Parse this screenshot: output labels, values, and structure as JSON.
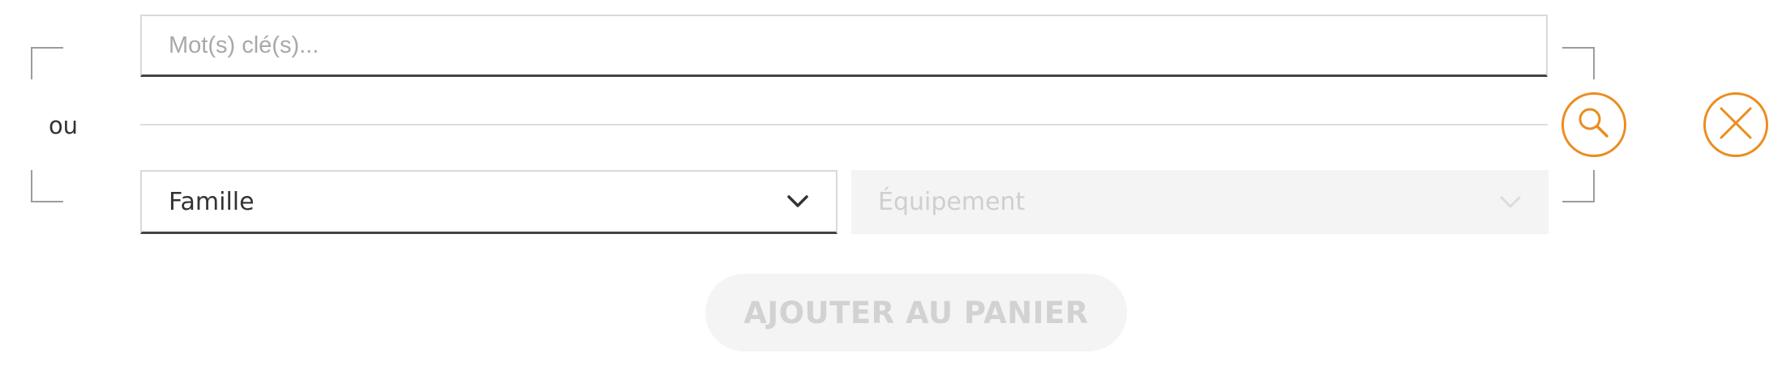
{
  "search": {
    "keyword_placeholder": "Mot(s) clé(s)...",
    "keyword_value": "",
    "separator_label": "ou",
    "family_select": {
      "selected": "Famille",
      "icon": "chevron-down-icon",
      "enabled": true
    },
    "equipment_select": {
      "selected": "Équipement",
      "icon": "chevron-down-icon",
      "enabled": false
    },
    "search_button": {
      "icon": "search-icon"
    },
    "clear_button": {
      "icon": "close-icon"
    }
  },
  "cart": {
    "add_label": "AJOUTER AU PANIER",
    "enabled": false
  },
  "colors": {
    "accent": "#ea8d1e",
    "input_border": "#d9d9d9",
    "input_underline": "#444444",
    "disabled_bg": "#f4f4f4",
    "disabled_text": "#d2d2d2",
    "text": "#333333",
    "placeholder": "#a8a8a8"
  }
}
